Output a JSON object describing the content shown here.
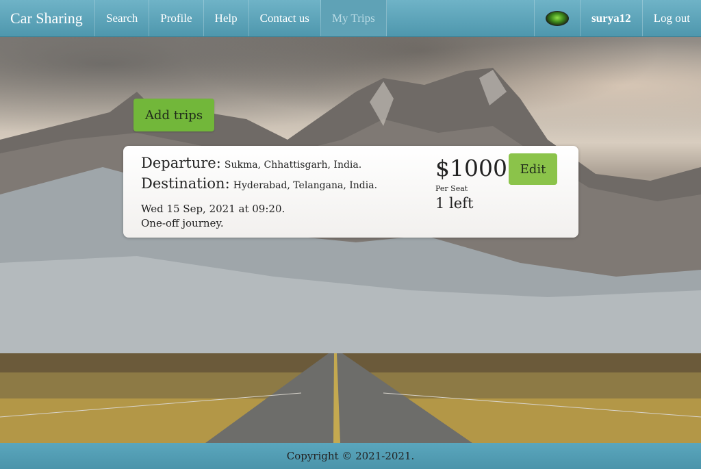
{
  "nav": {
    "brand": "Car Sharing",
    "items": [
      "Search",
      "Profile",
      "Help",
      "Contact us",
      "My Trips"
    ],
    "active": "My Trips",
    "username": "surya12",
    "logout": "Log out"
  },
  "actions": {
    "add_trips": "Add trips"
  },
  "trip": {
    "departure_label": "Departure:",
    "departure_value": "Sukma, Chhattisgarh, India.",
    "destination_label": "Destination:",
    "destination_value": "Hyderabad, Telangana, India.",
    "date_time": "Wed 15 Sep, 2021 at 09:20.",
    "journey_type": "One-off journey.",
    "price": "$1000",
    "price_unit": "Per Seat",
    "seats_left": "1 left",
    "edit_label": "Edit"
  },
  "footer": {
    "copyright": "Copyright © 2021-2021."
  },
  "colors": {
    "nav_bg": "#5aa6bd",
    "add_button": "#72b73a",
    "edit_button": "#8bc34a"
  }
}
